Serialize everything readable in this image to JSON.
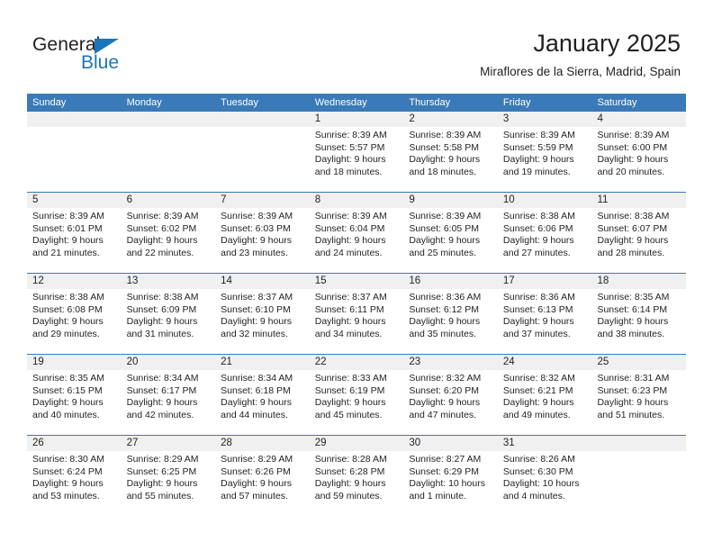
{
  "logo": {
    "word_one": "General",
    "word_two": "Blue",
    "triangle_icon": "triangle-icon",
    "brand_color": "#1b75bb"
  },
  "header": {
    "title": "January 2025",
    "subtitle": "Miraflores de la Sierra, Madrid, Spain"
  },
  "calendar": {
    "header_color": "#3a7ab8",
    "daynum_band_color": "#f0f0f0",
    "day_names": [
      "Sunday",
      "Monday",
      "Tuesday",
      "Wednesday",
      "Thursday",
      "Friday",
      "Saturday"
    ],
    "weeks": [
      [
        {
          "day": "",
          "lines": []
        },
        {
          "day": "",
          "lines": []
        },
        {
          "day": "",
          "lines": []
        },
        {
          "day": "1",
          "lines": [
            "Sunrise: 8:39 AM",
            "Sunset: 5:57 PM",
            "Daylight: 9 hours",
            "and 18 minutes."
          ]
        },
        {
          "day": "2",
          "lines": [
            "Sunrise: 8:39 AM",
            "Sunset: 5:58 PM",
            "Daylight: 9 hours",
            "and 18 minutes."
          ]
        },
        {
          "day": "3",
          "lines": [
            "Sunrise: 8:39 AM",
            "Sunset: 5:59 PM",
            "Daylight: 9 hours",
            "and 19 minutes."
          ]
        },
        {
          "day": "4",
          "lines": [
            "Sunrise: 8:39 AM",
            "Sunset: 6:00 PM",
            "Daylight: 9 hours",
            "and 20 minutes."
          ]
        }
      ],
      [
        {
          "day": "5",
          "lines": [
            "Sunrise: 8:39 AM",
            "Sunset: 6:01 PM",
            "Daylight: 9 hours",
            "and 21 minutes."
          ]
        },
        {
          "day": "6",
          "lines": [
            "Sunrise: 8:39 AM",
            "Sunset: 6:02 PM",
            "Daylight: 9 hours",
            "and 22 minutes."
          ]
        },
        {
          "day": "7",
          "lines": [
            "Sunrise: 8:39 AM",
            "Sunset: 6:03 PM",
            "Daylight: 9 hours",
            "and 23 minutes."
          ]
        },
        {
          "day": "8",
          "lines": [
            "Sunrise: 8:39 AM",
            "Sunset: 6:04 PM",
            "Daylight: 9 hours",
            "and 24 minutes."
          ]
        },
        {
          "day": "9",
          "lines": [
            "Sunrise: 8:39 AM",
            "Sunset: 6:05 PM",
            "Daylight: 9 hours",
            "and 25 minutes."
          ]
        },
        {
          "day": "10",
          "lines": [
            "Sunrise: 8:38 AM",
            "Sunset: 6:06 PM",
            "Daylight: 9 hours",
            "and 27 minutes."
          ]
        },
        {
          "day": "11",
          "lines": [
            "Sunrise: 8:38 AM",
            "Sunset: 6:07 PM",
            "Daylight: 9 hours",
            "and 28 minutes."
          ]
        }
      ],
      [
        {
          "day": "12",
          "lines": [
            "Sunrise: 8:38 AM",
            "Sunset: 6:08 PM",
            "Daylight: 9 hours",
            "and 29 minutes."
          ]
        },
        {
          "day": "13",
          "lines": [
            "Sunrise: 8:38 AM",
            "Sunset: 6:09 PM",
            "Daylight: 9 hours",
            "and 31 minutes."
          ]
        },
        {
          "day": "14",
          "lines": [
            "Sunrise: 8:37 AM",
            "Sunset: 6:10 PM",
            "Daylight: 9 hours",
            "and 32 minutes."
          ]
        },
        {
          "day": "15",
          "lines": [
            "Sunrise: 8:37 AM",
            "Sunset: 6:11 PM",
            "Daylight: 9 hours",
            "and 34 minutes."
          ]
        },
        {
          "day": "16",
          "lines": [
            "Sunrise: 8:36 AM",
            "Sunset: 6:12 PM",
            "Daylight: 9 hours",
            "and 35 minutes."
          ]
        },
        {
          "day": "17",
          "lines": [
            "Sunrise: 8:36 AM",
            "Sunset: 6:13 PM",
            "Daylight: 9 hours",
            "and 37 minutes."
          ]
        },
        {
          "day": "18",
          "lines": [
            "Sunrise: 8:35 AM",
            "Sunset: 6:14 PM",
            "Daylight: 9 hours",
            "and 38 minutes."
          ]
        }
      ],
      [
        {
          "day": "19",
          "lines": [
            "Sunrise: 8:35 AM",
            "Sunset: 6:15 PM",
            "Daylight: 9 hours",
            "and 40 minutes."
          ]
        },
        {
          "day": "20",
          "lines": [
            "Sunrise: 8:34 AM",
            "Sunset: 6:17 PM",
            "Daylight: 9 hours",
            "and 42 minutes."
          ]
        },
        {
          "day": "21",
          "lines": [
            "Sunrise: 8:34 AM",
            "Sunset: 6:18 PM",
            "Daylight: 9 hours",
            "and 44 minutes."
          ]
        },
        {
          "day": "22",
          "lines": [
            "Sunrise: 8:33 AM",
            "Sunset: 6:19 PM",
            "Daylight: 9 hours",
            "and 45 minutes."
          ]
        },
        {
          "day": "23",
          "lines": [
            "Sunrise: 8:32 AM",
            "Sunset: 6:20 PM",
            "Daylight: 9 hours",
            "and 47 minutes."
          ]
        },
        {
          "day": "24",
          "lines": [
            "Sunrise: 8:32 AM",
            "Sunset: 6:21 PM",
            "Daylight: 9 hours",
            "and 49 minutes."
          ]
        },
        {
          "day": "25",
          "lines": [
            "Sunrise: 8:31 AM",
            "Sunset: 6:23 PM",
            "Daylight: 9 hours",
            "and 51 minutes."
          ]
        }
      ],
      [
        {
          "day": "26",
          "lines": [
            "Sunrise: 8:30 AM",
            "Sunset: 6:24 PM",
            "Daylight: 9 hours",
            "and 53 minutes."
          ]
        },
        {
          "day": "27",
          "lines": [
            "Sunrise: 8:29 AM",
            "Sunset: 6:25 PM",
            "Daylight: 9 hours",
            "and 55 minutes."
          ]
        },
        {
          "day": "28",
          "lines": [
            "Sunrise: 8:29 AM",
            "Sunset: 6:26 PM",
            "Daylight: 9 hours",
            "and 57 minutes."
          ]
        },
        {
          "day": "29",
          "lines": [
            "Sunrise: 8:28 AM",
            "Sunset: 6:28 PM",
            "Daylight: 9 hours",
            "and 59 minutes."
          ]
        },
        {
          "day": "30",
          "lines": [
            "Sunrise: 8:27 AM",
            "Sunset: 6:29 PM",
            "Daylight: 10 hours",
            "and 1 minute."
          ]
        },
        {
          "day": "31",
          "lines": [
            "Sunrise: 8:26 AM",
            "Sunset: 6:30 PM",
            "Daylight: 10 hours",
            "and 4 minutes."
          ]
        },
        {
          "day": "",
          "lines": []
        }
      ]
    ]
  }
}
